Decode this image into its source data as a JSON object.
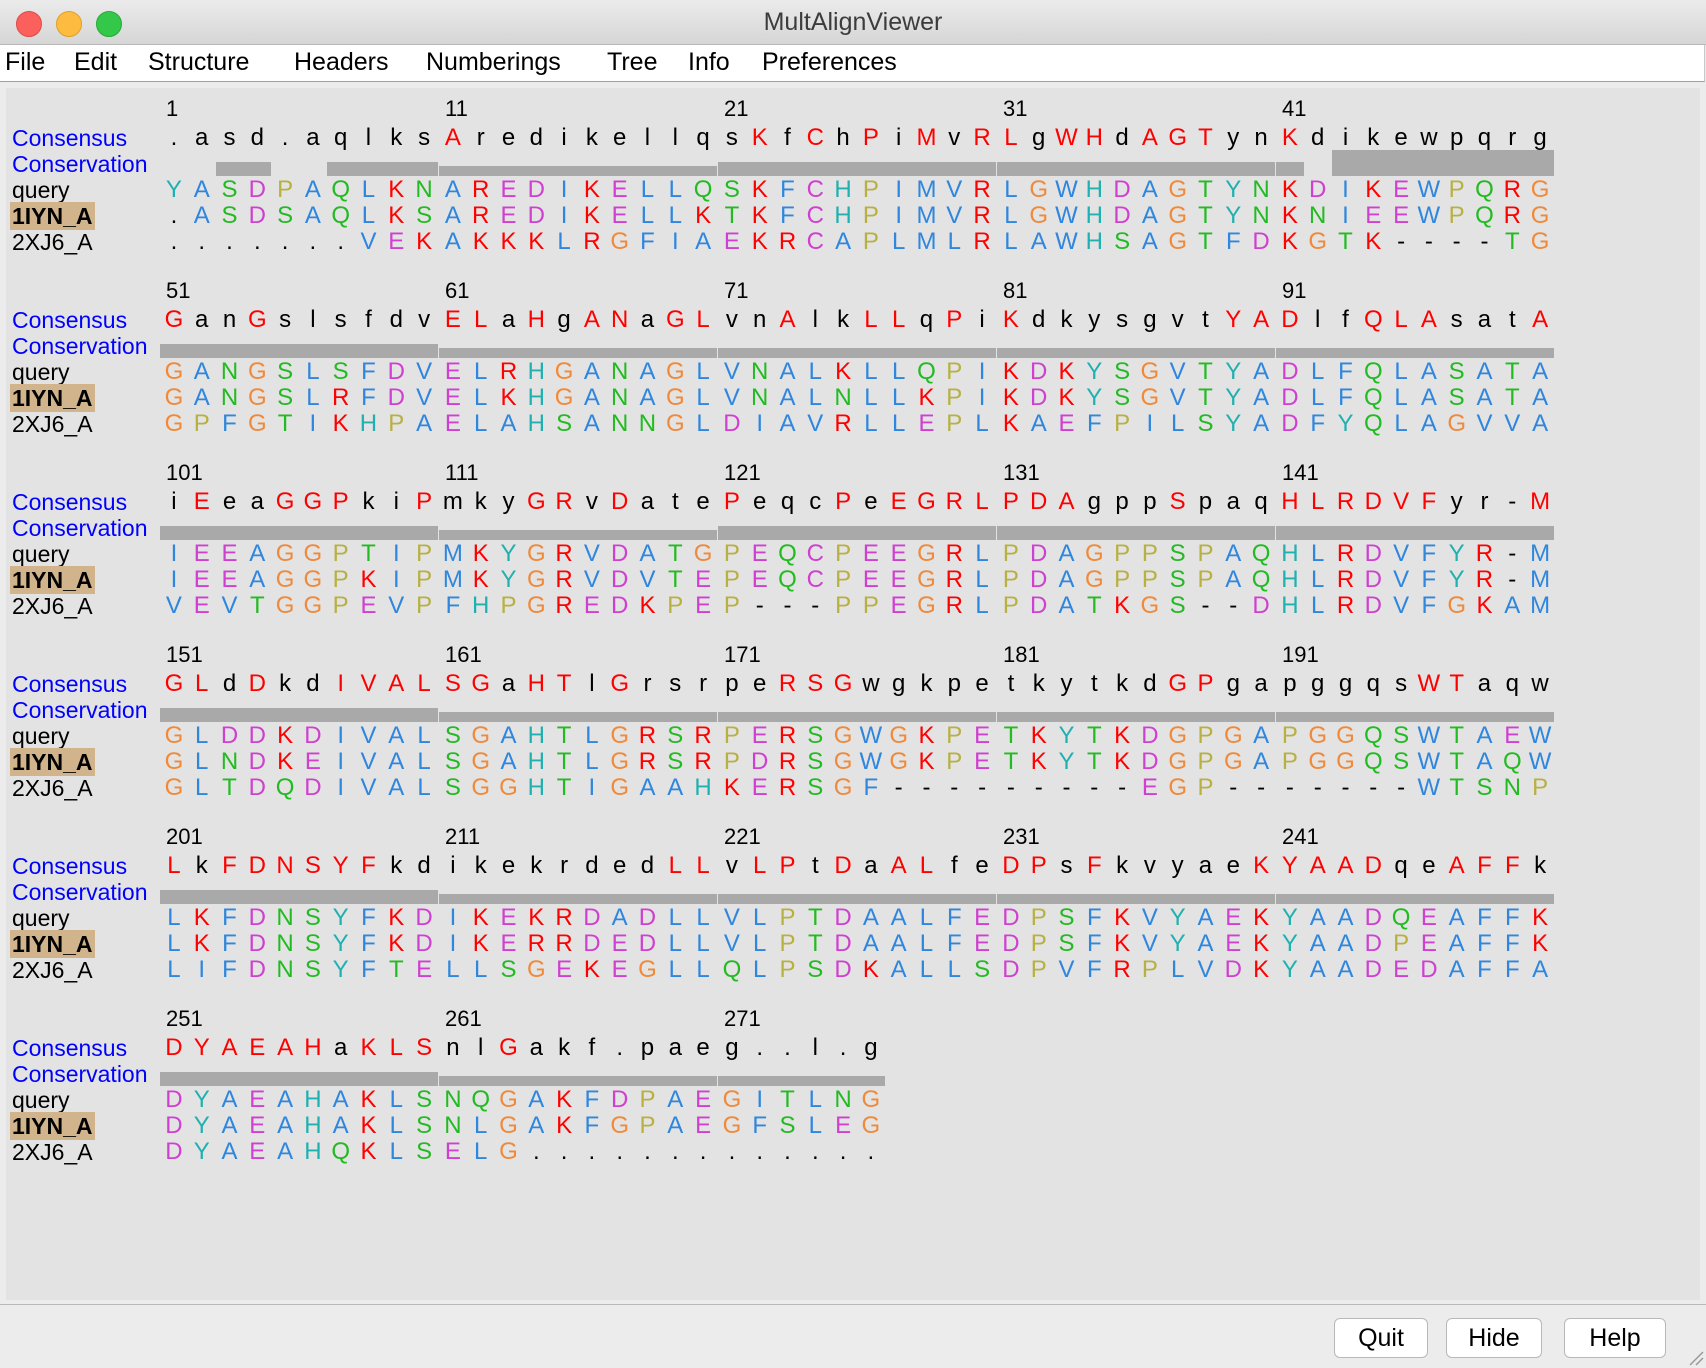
{
  "window": {
    "title": "MultAlignViewer"
  },
  "menubar": {
    "items": [
      "File",
      "Edit",
      "Structure",
      "Headers",
      "Numberings",
      "Tree",
      "Info",
      "Preferences"
    ]
  },
  "row_labels": [
    "Consensus",
    "Conservation",
    "query",
    "1IYN_A",
    "2XJ6_A"
  ],
  "reference_sequence": "1IYN_A",
  "colors": {
    "red": "#ff0000",
    "blue": "#2e86de",
    "magenta": "#d040d0",
    "green": "#22bb22",
    "orange": "#f08a3a",
    "cyan": "#20b0b0",
    "olive": "#b8b040",
    "black": "#000000",
    "conservation_bar": "#a9a9a9",
    "reference_highlight": "#d2b48c",
    "label_blue": "#0000ff"
  },
  "blocks": [
    {
      "numbers": [
        1,
        11,
        21,
        31,
        41
      ],
      "consensus": ".asd.aqlks Aredikellq sKfChPiMvR LgWHdAGTyn Kdikewpqrg",
      "query": "YASDPAQLKN AREDIKELLQ SKFCHPIMVR LGWHDAGTYN KDIKEWPQRG",
      "ref": ".ASDSAQLKS AREDIKELLK TKFCHPIMVR LGWHDAGTYN KNIEEWPQRG",
      "other": ".......VEK AKKKLRGFIA EKRCAPLMLR LAWHSAGTFD KGTK----TG",
      "conservation": "0022002222 1111111111 2222222222 2222222222 2033333333"
    },
    {
      "numbers": [
        51,
        61,
        71,
        81,
        91
      ],
      "consensus": "GanGslsfdv ELaHgANaGL vnAlkLLqPi KdkysgvtYA DlfQLAsatA",
      "query": "GANGSLSFDV ELRHGANAGL VNALKLLQPI KDKYSGVTYA DLFQLASATA",
      "ref": "GANGSLRFDV ELKHGANAGL VNALNLLKPI KDKYSGVTYA DLFQLASATA",
      "other": "GPFGTIKHPA ELAHSANNGL DIAVRLLEPL KAEFPILSYA DFYQLAGVVA",
      "conservation": "2222222222 1111111111 1111111111 1111111111 1111111111"
    },
    {
      "numbers": [
        101,
        111,
        121,
        131,
        141
      ],
      "consensus": "iEeaGGPkiP mkyGRvDate PeqcPeEGRL PDAgppSpaq HLRDVFyr-M",
      "query": "IEEAGGPTIP MKYGRVDATG PEQCPEEGRL PDAGPPSPAQ HLRDVFYR-M",
      "ref": "IEEAGGPKIP MKYGRVDVTE PEQCPEEGRL PDAGPPSPAQ HLRDVFYR-M",
      "other": "VEVTGGPEVP FHPGREDKPE P---PPEGRL PDATKGS--D HLRDVFGKAM",
      "conservation": "2222222222 1111111111 2222222222 2222222222 2222222222"
    },
    {
      "numbers": [
        151,
        161,
        171,
        181,
        191
      ],
      "consensus": "GLdDkdIVAL SGaHTlGrsr peRSGwgkpe tkytkdGPga pggqsWTaqw",
      "query": "GLDDKDIVAL SGAHTLGRSR PERSGWGKPE TKYTKDGPGA PGGQSWTAEW",
      "ref": "GLNDKEIVAL SGAHTLGRSR PDRSGWGKPE TKYTKDGPGA PGGQSWTAQW",
      "other": "GLTDQDIVAL SGGHTIGAAH KERSGF---- -----EGP-- -----WTSNP",
      "conservation": "2222222222 1111111111 1111111111 1111111111 1111111111"
    },
    {
      "numbers": [
        201,
        211,
        221,
        231,
        241
      ],
      "consensus": "LkFDNSYFkd ikekrdedLL vLPtDaALfe DPsFkvyaeK YAADqeAFFk",
      "query": "LKFDNSYFKD IKEKRDADLL VLPTDAALFE DPSFKVYAEK YAADQEAFFK",
      "ref": "LKFDNSYFKD IKERRDEDLL VLPTDAALFE DPSFKVYAEK YAADPEAFFK",
      "other": "LIFDNSYFTE LLSGEKEGLL QLPSDKALLS DPVFRPLVDK YAADEDAFFA",
      "conservation": "2222222222 1111111111 1111111111 1111111111 1111111111"
    },
    {
      "numbers": [
        251,
        261,
        271
      ],
      "consensus": "DYAEAHaKLS nlGakf.pae g..l.g",
      "query": "DYAEAHAKLS NQGAKFDPAE GITLNG",
      "ref": "DYAEAHAKLS NLGAKFGPAE GFSLEG",
      "other": "DYAEAHQKLS ELG....... ......",
      "conservation": "2222222222 1111111111 111111"
    }
  ],
  "buttons": {
    "quit": "Quit",
    "hide": "Hide",
    "help": "Help"
  }
}
